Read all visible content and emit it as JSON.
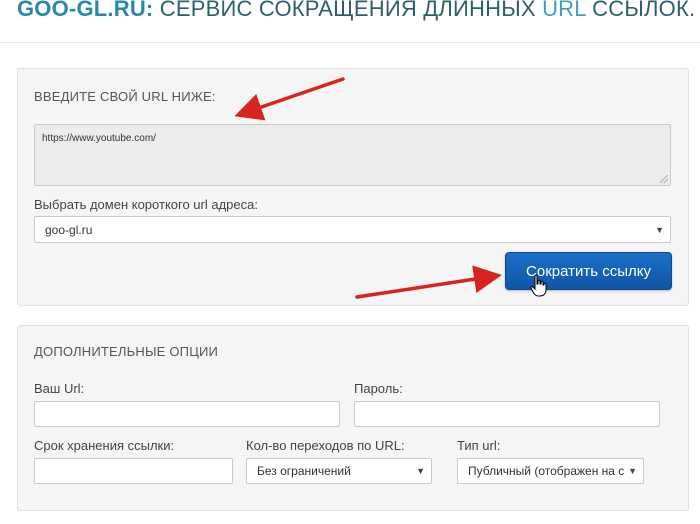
{
  "header": {
    "brand": "GOO-GL.RU:",
    "title_part1": " СЕРВИС СОКРАЩЕНИЯ ДЛИННЫХ ",
    "title_url": "URL",
    "title_part2": " ССЫЛОК.",
    "scissors_glyph": "✂"
  },
  "shorten_form": {
    "section_title": "ВВЕДИТЕ СВОЙ URL НИЖЕ:",
    "url_value": "https://www.youtube.com/",
    "domain_label": "Выбрать домен короткого url адреса:",
    "domain_selected": "goo-gl.ru",
    "submit_label": "Сократить ссылку"
  },
  "options": {
    "section_title": "ДОПОЛНИТЕЛЬНЫЕ ОПЦИИ",
    "custom_url_label": "Ваш Url:",
    "custom_url_value": "",
    "password_label": "Пароль:",
    "password_value": "",
    "expiry_label": "Срок хранения ссылки:",
    "expiry_value": "",
    "clicks_label": "Кол-во переходов по URL:",
    "clicks_selected": "Без ограничений",
    "type_label": "Тип url:",
    "type_selected": "Публичный (отображен на с"
  },
  "colors": {
    "brand": "#2a8aa5",
    "button": "#1565c0",
    "annotation_arrow": "#d9231f"
  }
}
